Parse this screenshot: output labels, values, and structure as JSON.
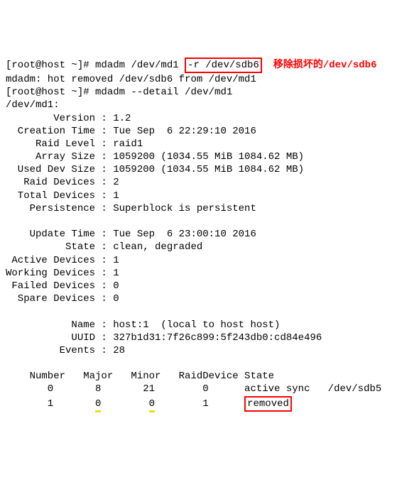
{
  "line1": {
    "prompt": "[root@host ~]# mdadm /dev/md1 ",
    "boxed": "-r /dev/sdb6",
    "annotation": "移除损坏的/dev/sdb6"
  },
  "line2": "mdadm: hot removed /dev/sdb6 from /dev/md1",
  "line3": "[root@host ~]# mdadm --detail /dev/md1",
  "line4": "/dev/md1:",
  "details": {
    "version": "        Version : 1.2",
    "creation_time": "  Creation Time : Tue Sep  6 22:29:10 2016",
    "raid_level": "     Raid Level : raid1",
    "array_size": "     Array Size : 1059200 (1034.55 MiB 1084.62 MB)",
    "used_dev_size": "  Used Dev Size : 1059200 (1034.55 MiB 1084.62 MB)",
    "raid_devices": "   Raid Devices : 2",
    "total_devices": "  Total Devices : 1",
    "persistence": "    Persistence : Superblock is persistent",
    "blank1": " ",
    "update_time": "    Update Time : Tue Sep  6 23:00:10 2016",
    "state": "          State : clean, degraded",
    "active_dev": " Active Devices : 1",
    "working_dev": "Working Devices : 1",
    "failed_dev": " Failed Devices : 0",
    "spare_dev": "  Spare Devices : 0",
    "blank2": " ",
    "name": "           Name : host:1  (local to host host)",
    "uuid": "           UUID : 327b1d31:7f26c899:5f243db0:cd84e496",
    "events": "         Events : 28"
  },
  "table": {
    "header": "    Number   Major   Minor   RaidDevice State",
    "row0": "       0       8       21        0      active sync   /dev/sdb5",
    "row1": {
      "pre": "       1       ",
      "uy1": "0",
      "mid1": "        ",
      "uy2": "0",
      "mid2": "        1      ",
      "box": "removed"
    }
  }
}
